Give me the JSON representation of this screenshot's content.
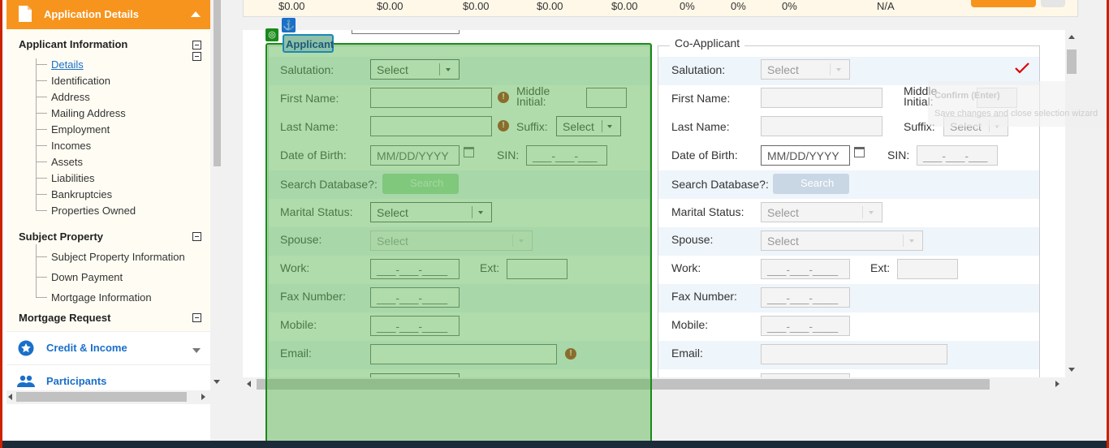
{
  "sidebar": {
    "header": "Application Details",
    "sections": [
      {
        "title": "Applicant Information",
        "items": [
          "Details",
          "Identification",
          "Address",
          "Mailing Address",
          "Employment",
          "Incomes",
          "Assets",
          "Liabilities",
          "Bankruptcies",
          "Properties Owned"
        ]
      },
      {
        "title": "Subject Property",
        "items": [
          "Subject Property Information",
          "Down Payment",
          "Mortgage Information"
        ]
      },
      {
        "title": "Mortgage Request",
        "items": []
      }
    ],
    "nav": [
      {
        "label": "Credit & Income",
        "icon": "star-icon"
      },
      {
        "label": "Participants",
        "icon": "people-icon"
      }
    ]
  },
  "summary_strip": [
    "$0.00",
    "$0.00",
    "$0.00",
    "$0.00",
    "$0.00",
    "0%",
    "0%",
    "0%",
    "N/A"
  ],
  "applicant": {
    "legend": "Applicant",
    "salutation_label": "Salutation:",
    "salutation_value": "Select",
    "first_name_label": "First Name:",
    "middle_initial_label_1": "Middle",
    "middle_initial_label_2": "Initial:",
    "last_name_label": "Last Name:",
    "suffix_label": "Suffix:",
    "suffix_value": "Select",
    "dob_label": "Date of Birth:",
    "dob_placeholder": "MM/DD/YYYY",
    "sin_label": "SIN:",
    "sin_placeholder": "___-___-___",
    "search_db_label": "Search Database?:",
    "search_button": "Search",
    "marital_label": "Marital Status:",
    "marital_value": "Select",
    "spouse_label": "Spouse:",
    "spouse_value": "Select",
    "work_label": "Work:",
    "work_placeholder": "___-___-____",
    "ext_label": "Ext:",
    "fax_label": "Fax Number:",
    "fax_placeholder": "___-___-____",
    "mobile_label": "Mobile:",
    "mobile_placeholder": "___-___-____",
    "email_label": "Email:"
  },
  "co_applicant": {
    "legend": "Co-Applicant",
    "salutation_label": "Salutation:",
    "salutation_value": "Select",
    "first_name_label": "First Name:",
    "middle_initial_label_1": "Middle",
    "middle_initial_label_2": "Initial:",
    "last_name_label": "Last Name:",
    "suffix_label": "Suffix:",
    "suffix_value": "Select",
    "dob_label": "Date of Birth:",
    "dob_placeholder": "MM/DD/YYYY",
    "sin_label": "SIN:",
    "sin_placeholder": "___-___-___",
    "search_db_label": "Search Database?:",
    "search_button": "Search",
    "marital_label": "Marital Status:",
    "marital_value": "Select",
    "spouse_label": "Spouse:",
    "spouse_value": "Select",
    "work_label": "Work:",
    "work_placeholder": "___-___-____",
    "ext_label": "Ext:",
    "fax_label": "Fax Number:",
    "fax_placeholder": "___-___-____",
    "mobile_label": "Mobile:",
    "mobile_placeholder": "___-___-____",
    "email_label": "Email:"
  },
  "confirm_tooltip": {
    "title": "Confirm (Enter)",
    "subtitle": "Save changes and close selection wizard"
  },
  "colors": {
    "brand": "#f7941d",
    "link": "#1a6fc9",
    "overlay": "#62b958",
    "error": "#b51f00",
    "check": "#dd0000"
  }
}
